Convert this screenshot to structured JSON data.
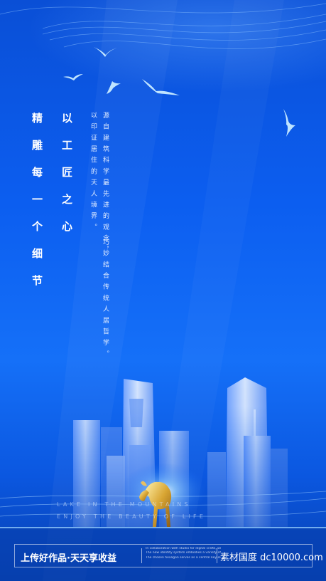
{
  "poster": {
    "headline_col1": "以工匠之心",
    "headline_col2": "精雕每一个细节",
    "body_col1": "源自建筑科学最先进的观念，",
    "body_col2": "以印证居住的天人境界。",
    "body_col3": "巧妙结合传统人居哲学。",
    "en_line1": "LAKE IN THE MOUNTAINS",
    "en_line2": "ENJOY THE BEAUTY OF LIFE"
  },
  "footer": {
    "left_text": "上传好作品·天天享收益",
    "small_lines": [
      "In collaboration with studio for digital crafts, we created a",
      "The new identity system embodies a variety of perspectives",
      "The chosen hexagon serves as a central key element"
    ],
    "right_text": "素材国度  dc10000.com"
  },
  "colors": {
    "bg_top": "#0a4fd6",
    "bg_mid": "#1570f8",
    "bg_bottom": "#073fae",
    "accent_gold": "#d8a533"
  },
  "icons": [
    "seagull-icon",
    "golden-deer-statue",
    "city-skyline"
  ]
}
